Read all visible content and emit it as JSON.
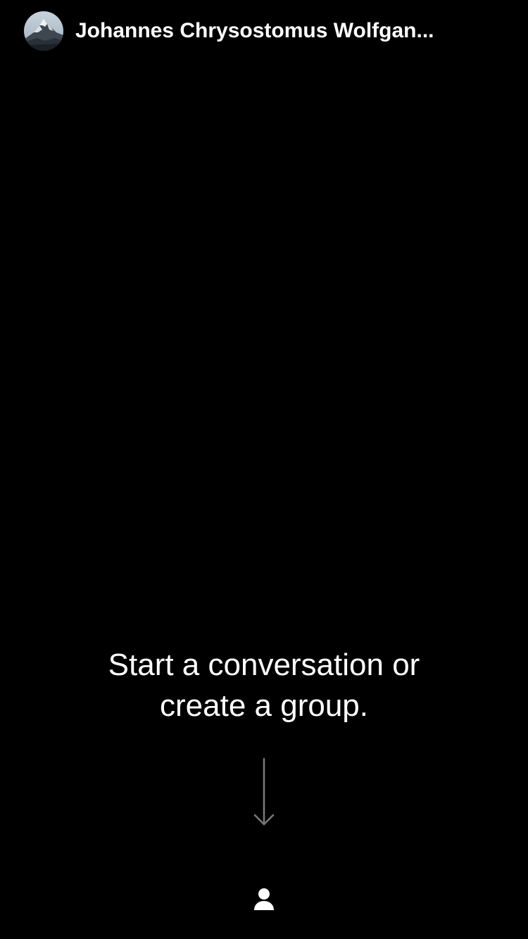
{
  "header": {
    "profile_name": "Johannes Chrysostomus Wolfgan...",
    "avatar_icon": "mountain-avatar-icon"
  },
  "empty_state": {
    "line1": "Start a conversation or",
    "line2": "create a group."
  },
  "arrow_icon": "arrow-down-icon",
  "footer": {
    "contacts_icon": "person-icon"
  },
  "colors": {
    "background": "#000000",
    "text": "#ffffff",
    "arrow": "#7a7a7a"
  }
}
